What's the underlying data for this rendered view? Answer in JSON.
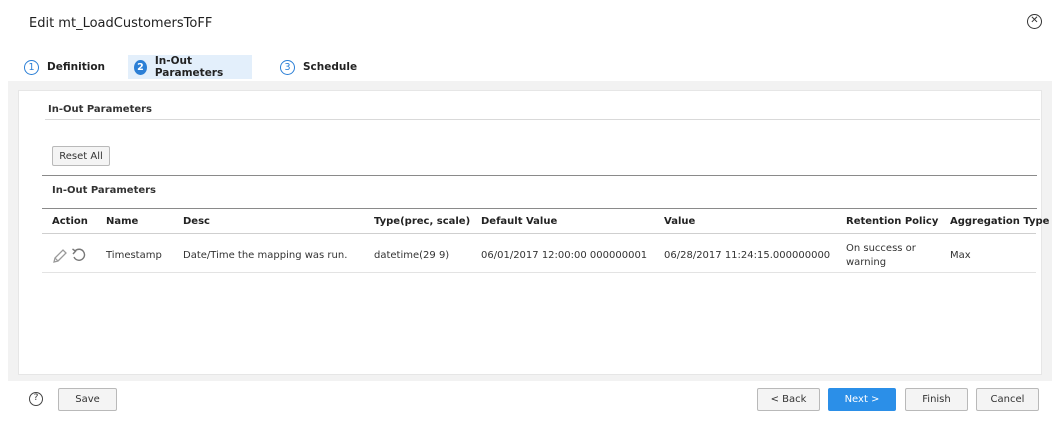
{
  "dialog": {
    "title": "Edit mt_LoadCustomersToFF"
  },
  "steps": [
    {
      "num": "1",
      "label": "Definition"
    },
    {
      "num": "2",
      "label": "In-Out Parameters"
    },
    {
      "num": "3",
      "label": "Schedule"
    }
  ],
  "section": {
    "title": "In-Out Parameters",
    "reset_label": "Reset All",
    "table_title": "In-Out Parameters"
  },
  "table": {
    "headers": [
      "Action",
      "Name",
      "Desc",
      "Type(prec, scale)",
      "Default Value",
      "Value",
      "Retention Policy",
      "Aggregation Type"
    ],
    "rows": [
      {
        "name": "Timestamp",
        "desc": "Date/Time the mapping was run.",
        "type": "datetime(29 9)",
        "default_value": "06/01/2017 12:00:00 000000001",
        "value": "06/28/2017 11:24:15.000000000",
        "retention_policy": "On success or warning",
        "aggregation_type": "Max"
      }
    ]
  },
  "footer": {
    "save_label": "Save",
    "back_label": "< Back",
    "next_label": "Next >",
    "finish_label": "Finish",
    "cancel_label": "Cancel"
  },
  "colors": {
    "accent": "#2b8fe8",
    "step_active_bg": "#e3effb"
  }
}
